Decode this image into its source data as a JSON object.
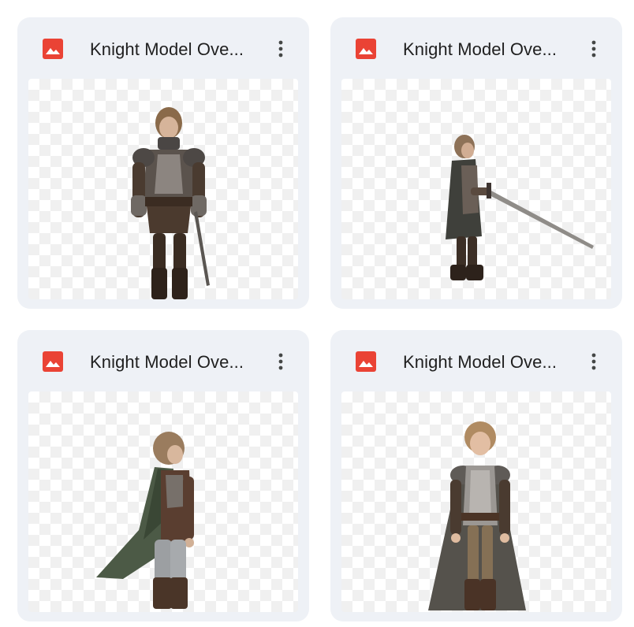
{
  "files": [
    {
      "title": "Knight Model Ove...",
      "icon": "image-file-icon",
      "menu_icon": "more-vert-icon",
      "thumbnail": "knight-front-view"
    },
    {
      "title": "Knight Model Ove...",
      "icon": "image-file-icon",
      "menu_icon": "more-vert-icon",
      "thumbnail": "knight-side-view-sword"
    },
    {
      "title": "Knight Model Ove...",
      "icon": "image-file-icon",
      "menu_icon": "more-vert-icon",
      "thumbnail": "knight-back-three-quarter-cape"
    },
    {
      "title": "Knight Model Ove...",
      "icon": "image-file-icon",
      "menu_icon": "more-vert-icon",
      "thumbnail": "knight-front-smiling-cape"
    }
  ],
  "colors": {
    "card_bg": "#eef1f6",
    "image_icon_red": "#ea4335",
    "title_text": "#1f1f1f",
    "icon_gray": "#444746"
  }
}
